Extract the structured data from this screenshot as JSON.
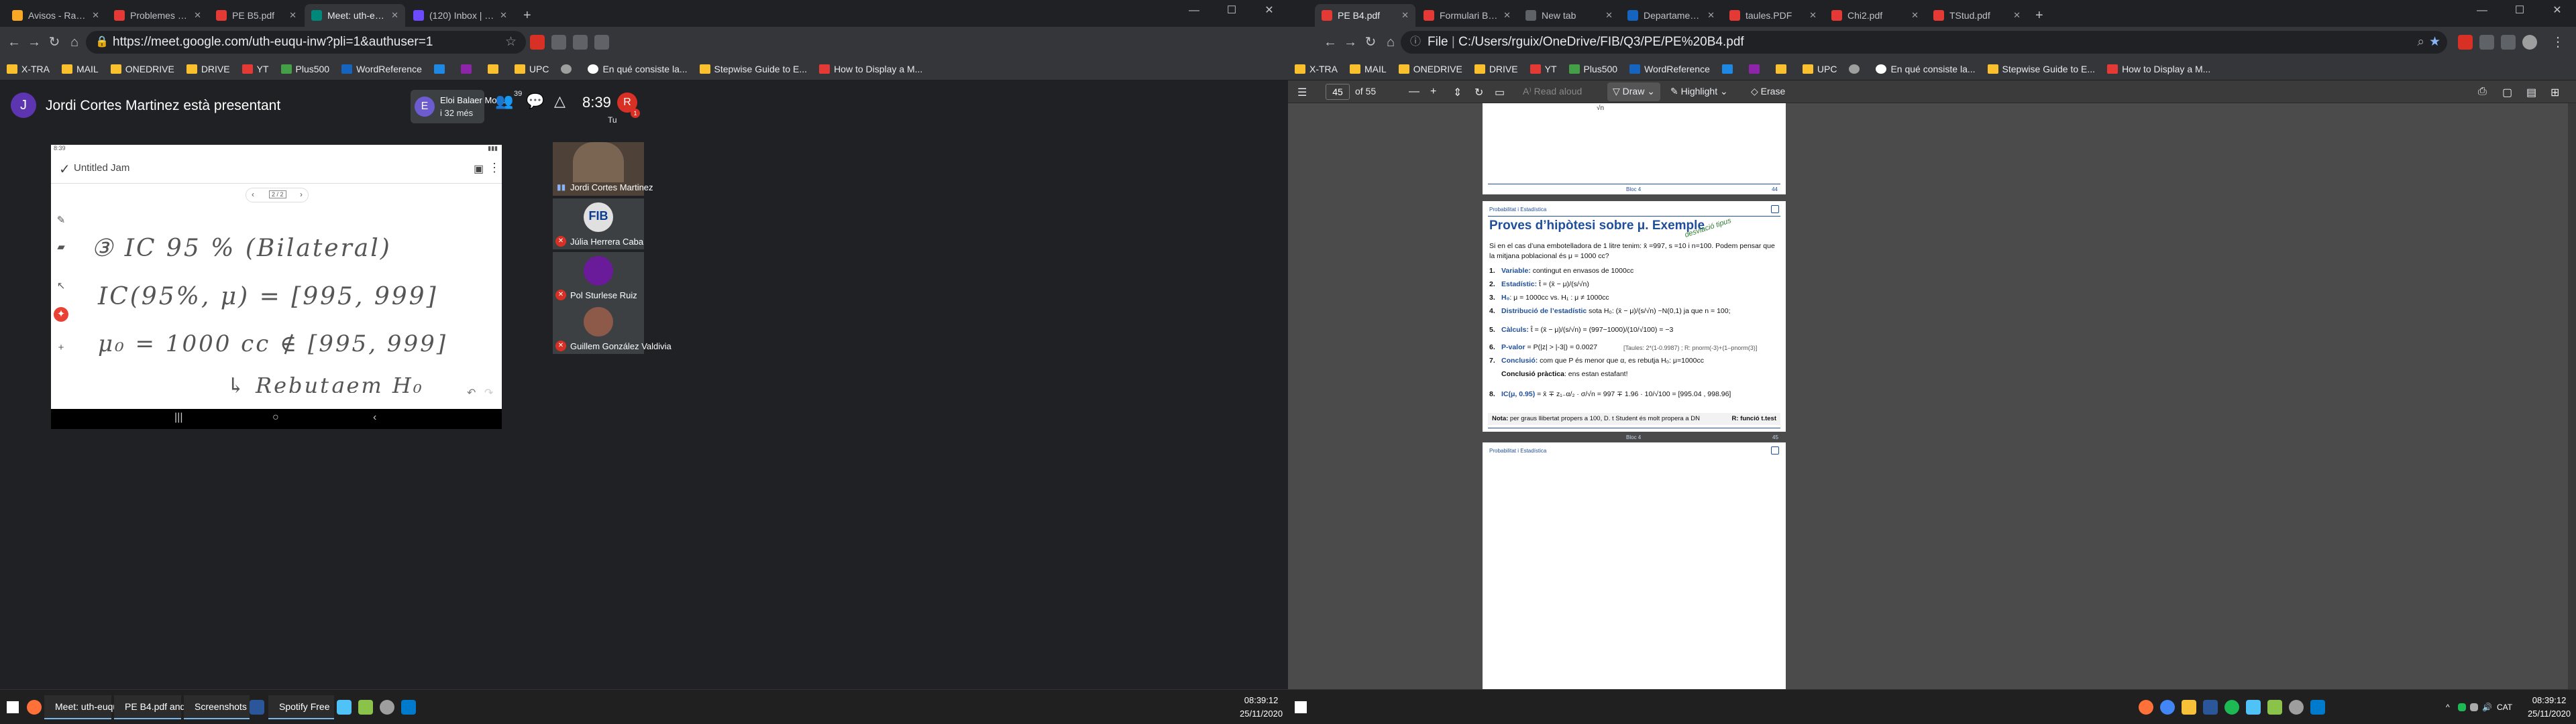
{
  "s1": {
    "tabs": [
      {
        "label": "Avisos - Racó de la FIB",
        "color": "#f9a825"
      },
      {
        "label": "Problemes B4.pdf",
        "color": "#e53935"
      },
      {
        "label": "PE B5.pdf",
        "color": "#e53935"
      },
      {
        "label": "Meet: uth-euqu-inw",
        "color": "#00897b",
        "active": true
      },
      {
        "label": "(120) Inbox | rguixaro@protonm...",
        "color": "#6d4aff"
      }
    ],
    "url": "https://meet.google.com/uth-euqu-inw?pli=1&authuser=1",
    "bookmarks": [
      "X-TRA",
      "MAIL",
      "ONEDRIVE",
      "DRIVE",
      "YT",
      "Plus500",
      "WordReference",
      "",
      "",
      "",
      "UPC",
      "",
      "En qué consiste la...",
      "Stepwise Guide to E...",
      "How to Display a M..."
    ],
    "meet": {
      "presenter_initial": "J",
      "presenting": "Jordi Cortes Martinez està presentant",
      "pinned_initial": "E",
      "pinned_name": "Eloi Balaer Mora...",
      "pinned_time": "i 32 més",
      "participants_count": "39",
      "clock": "8:39",
      "me_label": "Tu",
      "me_initial": "R",
      "me_badge": "1",
      "device_time": "8:39",
      "jam_title": "Untitled Jam",
      "jam_page": "2 / 2",
      "handwriting": [
        "③ IC 95 % (Bilateral)",
        "IC(95%, μ) = [995, 999]",
        "μ₀ = 1000 cc ∉ [995, 999]",
        "↳ Rebutgem H₀"
      ],
      "tiles": [
        "Jordi Cortes Martinez",
        "Júlia Herrera Caba",
        "Pol Sturlese Ruiz",
        "Guillem González Valdivia"
      ],
      "fib": "FIB"
    }
  },
  "s2": {
    "tabs": [
      {
        "label": "PE B4.pdf",
        "color": "#e53935",
        "active": true
      },
      {
        "label": "Formulari B4-B6.pdf",
        "color": "#e53935"
      },
      {
        "label": "New tab",
        "color": "#5f6368"
      },
      {
        "label": "Departament d'Estadi...",
        "color": "#1565c0"
      },
      {
        "label": "taules.PDF",
        "color": "#e53935"
      },
      {
        "label": "Chi2.pdf",
        "color": "#e53935"
      },
      {
        "label": "TStud.pdf",
        "color": "#e53935"
      }
    ],
    "url_prefix": "File",
    "url": "C:/Users/rguix/OneDrive/FIB/Q3/PE/PE%20B4.pdf",
    "bookmarks": [
      "X-TRA",
      "MAIL",
      "ONEDRIVE",
      "DRIVE",
      "YT",
      "Plus500",
      "WordReference",
      "",
      "",
      "",
      "UPC",
      "",
      "En qué consiste la...",
      "Stepwise Guide to E...",
      "How to Display a M..."
    ],
    "pdf": {
      "page": "45",
      "of": "of 55",
      "read_aloud": "Read aloud",
      "draw": "Draw",
      "highlight": "Highlight",
      "erase": "Erase",
      "prev_footer": "Bloc 4",
      "prev_page": "44",
      "header": "Probabilitat i Estadística",
      "title": "Proves d’hipòtesi sobre μ. Exemple",
      "annotation": "desviació tipus",
      "intro": "Si en el cas d’una embotelladora de 1 litre tenim: x̄ =997, s =10 i n=100. Podem pensar que la mitjana poblacional és μ = 1000 cc?",
      "steps": [
        {
          "n": "1.",
          "k": "Variable:",
          "t": " contingut en envasos de 1000cc"
        },
        {
          "n": "2.",
          "k": "Estadístic:",
          "t": " t̂ = (x̄ − μ)/(s/√n)"
        },
        {
          "n": "3.",
          "k": "H₀",
          "t": ": μ = 1000cc          vs.       H₁ : μ ≠ 1000cc"
        },
        {
          "n": "4.",
          "k": "Distribució de l’estadístic",
          "t": " sota H₀: (x̄ − μ)/(s/√n) ~N(0,1) ja que n = 100;"
        },
        {
          "n": "5.",
          "k": "Càlculs:",
          "t": " t̂ = (x̄ − μ)/(s/√n) = (997−1000)/(10/√100) = −3"
        },
        {
          "n": "6.",
          "k": "P-valor",
          "t": " = P(|z| > |-3|) = 0.0027"
        },
        {
          "n": "7.",
          "k": "Conclusió:",
          "t": " com que P és menor que α, es rebutja H₀: μ=1000cc"
        },
        {
          "n": "",
          "k": "Conclusió pràctica",
          "t": ": ens estan estafant!"
        },
        {
          "n": "8.",
          "k": "IC(μ, 0.95)",
          "t": " = x̄ ∓ z₁₋α/₂ · σ/√n = 997 ∓ 1.96 · 10/√100 = [995.04 , 998.96]"
        }
      ],
      "taules": "[Taules: 2*(1-0.9987) ; R: pnorm(-3)+(1–pnorm(3)]",
      "note_k": "Nota:",
      "note": " per graus llibertat propers a 100, D. t Student és molt propera a DN",
      "note_r": "R: funció t.test",
      "footer": "Bloc 4",
      "page_num": "45",
      "next_header": "Probabilitat i Estadística"
    }
  },
  "taskbar1": {
    "items": [
      "Meet: uth-euqu-inw...",
      "PE B4.pdf and 6 mo...",
      "Screenshots",
      "",
      "Spotify Free"
    ],
    "time": "08:39:12",
    "date": "25/11/2020"
  },
  "taskbar2": {
    "lang": "CAT",
    "time": "08:39:12",
    "date": "25/11/2020"
  }
}
